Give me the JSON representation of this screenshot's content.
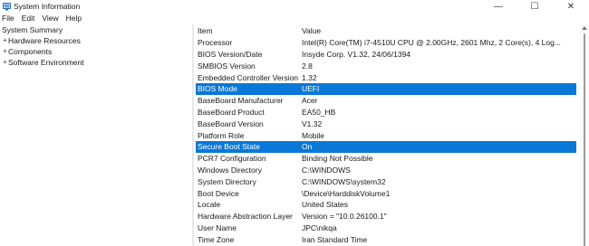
{
  "window": {
    "title": "System Information",
    "controls": {
      "minimize": "—",
      "maximize": "☐",
      "close": "✕"
    }
  },
  "menu": [
    "File",
    "Edit",
    "View",
    "Help"
  ],
  "tree": {
    "root": "System Summary",
    "children": [
      {
        "expander": "+",
        "label": "Hardware Resources"
      },
      {
        "expander": "+",
        "label": "Components"
      },
      {
        "expander": "+",
        "label": "Software Environment"
      }
    ]
  },
  "table": {
    "headers": {
      "item": "Item",
      "value": "Value"
    },
    "rows": [
      {
        "item": "Processor",
        "value": "Intel(R) Core(TM) i7-4510U CPU @ 2.00GHz, 2601 Mhz, 2 Core(s), 4 Log..."
      },
      {
        "item": "BIOS Version/Date",
        "value": "Insyde Corp. V1.32, 24/06/1394"
      },
      {
        "item": "SMBIOS Version",
        "value": "2.8"
      },
      {
        "item": "Embedded Controller Version",
        "value": "1.32"
      },
      {
        "item": "BIOS Mode",
        "value": "UEFI",
        "selected": true
      },
      {
        "item": "BaseBoard Manufacturer",
        "value": "Acer"
      },
      {
        "item": "BaseBoard Product",
        "value": "EA50_HB"
      },
      {
        "item": "BaseBoard Version",
        "value": "V1.32"
      },
      {
        "item": "Platform Role",
        "value": "Mobile"
      },
      {
        "item": "Secure Boot State",
        "value": "On",
        "selected": true
      },
      {
        "item": "PCR7 Configuration",
        "value": "Binding Not Possible"
      },
      {
        "item": "Windows Directory",
        "value": "C:\\WINDOWS"
      },
      {
        "item": "System Directory",
        "value": "C:\\WINDOWS\\system32"
      },
      {
        "item": "Boot Device",
        "value": "\\Device\\HarddiskVolume1"
      },
      {
        "item": "Locale",
        "value": "United States"
      },
      {
        "item": "Hardware Abstraction Layer",
        "value": "Version = \"10.0.26100.1\""
      },
      {
        "item": "User Name",
        "value": "JPC\\nikqa"
      },
      {
        "item": "Time Zone",
        "value": "Iran Standard Time"
      }
    ]
  },
  "colors": {
    "selection": "#0a78d7",
    "selection_text": "#ffffff"
  }
}
